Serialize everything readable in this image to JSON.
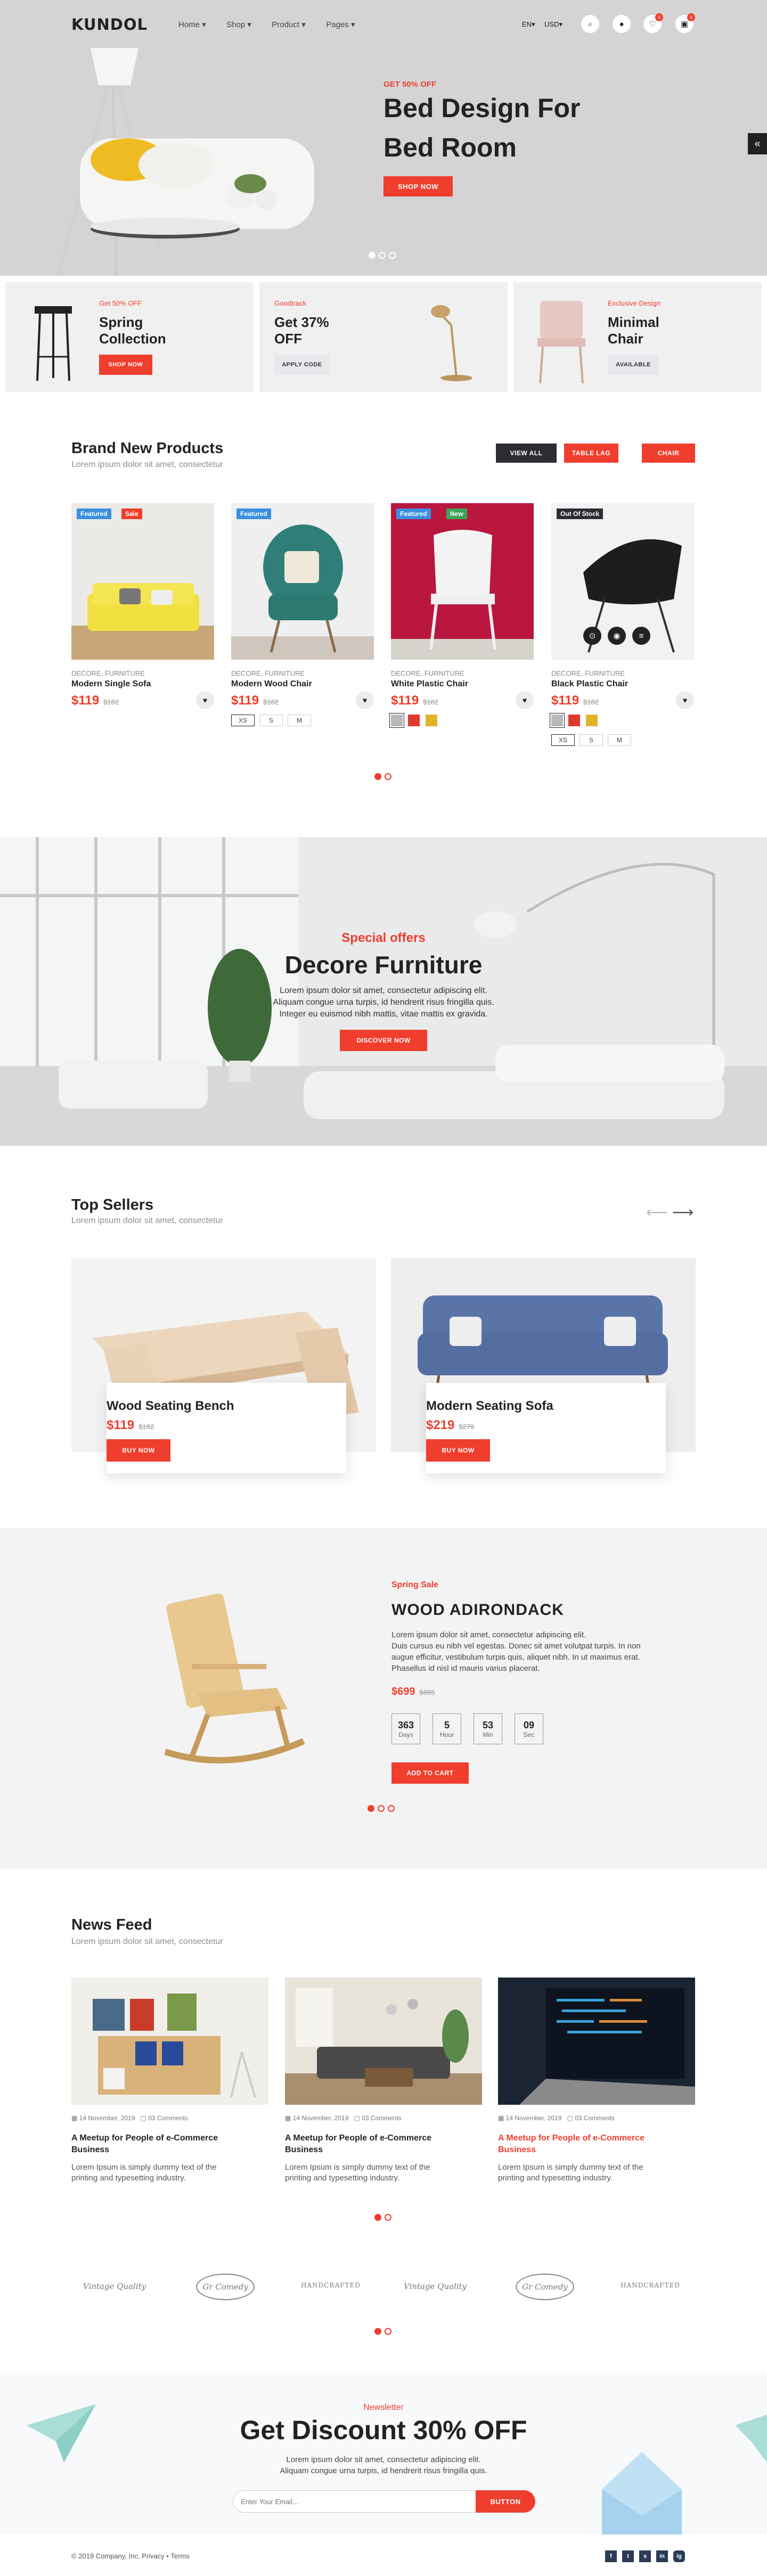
{
  "header": {
    "logo": "KUNDOL",
    "nav": [
      "Home",
      "Shop",
      "Product",
      "Pages"
    ],
    "currency": {
      "lang": "EN",
      "money": "USD"
    },
    "badges": {
      "wishlist": "0",
      "cart": "0"
    }
  },
  "hero": {
    "kicker": "GET 50% OFF",
    "title_line1": "Bed Design For",
    "title_line2": "Bed Room",
    "button": "SHOP NOW",
    "side_icon": "«"
  },
  "promos": [
    {
      "tag": "Get 50% OFF",
      "title_line1": "Spring",
      "title_line2": "Collection",
      "button": "SHOP NOW"
    },
    {
      "tag": "Goodtrack",
      "title_line1": "Get 37%",
      "title_line2": "OFF",
      "button": "APPLY CODE"
    },
    {
      "tag": "Exclusive Design",
      "title_line1": "Minimal",
      "title_line2": "Chair",
      "button": "AVAILABLE"
    }
  ],
  "new_products": {
    "title": "Brand New Products",
    "subtitle": "Lorem ipsum dolor sit amet, consectetur",
    "filters": [
      "VIEW ALL",
      "TABLE LAG",
      "CHAIR"
    ],
    "items": [
      {
        "tags": [
          "Featured",
          "Sale"
        ],
        "category": "DECORE, FURNITURE",
        "name": "Modern Single Sofa",
        "price": "$119",
        "old_price": "$182",
        "sizes": [],
        "swatches": []
      },
      {
        "tags": [
          "Featured"
        ],
        "category": "DECORE, FURNITURE",
        "name": "Modern Wood Chair",
        "price": "$119",
        "old_price": "$182",
        "sizes": [
          "XS",
          "S",
          "M"
        ],
        "swatches": []
      },
      {
        "tags": [
          "Featured",
          "New"
        ],
        "category": "DECORE, FURNITURE",
        "name": "White Plastic Chair",
        "price": "$119",
        "old_price": "$182",
        "sizes": [],
        "swatches": [
          "#b9b9b9",
          "#e0382d",
          "#e0b42a"
        ]
      },
      {
        "tags": [
          "Out Of Stock"
        ],
        "category": "DECORE, FURNITURE",
        "name": "Black Plastic Chair",
        "price": "$119",
        "old_price": "$182",
        "sizes": [
          "XS",
          "S",
          "M"
        ],
        "swatches": [
          "#b9b9b9",
          "#e0382d",
          "#e0b42a"
        ]
      }
    ]
  },
  "offer": {
    "kicker": "Special offers",
    "title": "Decore Furniture",
    "text_line1": "Lorem ipsum dolor sit amet, consectetur adipiscing elit.",
    "text_line2": "Aliquam congue urna turpis, id hendrerit risus fringilla quis.",
    "text_line3": "Integer eu euismod nibh mattis, vitae mattis ex gravida.",
    "button": "DISCOVER NOW"
  },
  "top_sellers": {
    "title": "Top Sellers",
    "subtitle": "Lorem ipsum dolor sit amet, consectetur",
    "items": [
      {
        "name": "Wood Seating Bench",
        "price": "$119",
        "old_price": "$182",
        "button": "BUY NOW"
      },
      {
        "name": "Modern Seating Sofa",
        "price": "$219",
        "old_price": "$279",
        "button": "BUY NOW"
      }
    ]
  },
  "deal": {
    "kicker": "Spring Sale",
    "title": "WOOD ADIRONDACK",
    "text_line1": "Lorem ipsum dolor sit amet, consectetur adipiscing elit.",
    "text_line2": "Duis cursus eu nibh vel egestas. Donec sit amet volutpat turpis. In non",
    "text_line3": "augue efficitur, vestibulum turpis quis, aliquet nibh. In ut maximus erat.",
    "text_line4": "Phasellus id nisl id mauris varius placerat.",
    "price": "$699",
    "old_price": "$685",
    "countdown": [
      {
        "value": "363",
        "unit": "Days"
      },
      {
        "value": "5",
        "unit": "Hour"
      },
      {
        "value": "53",
        "unit": "Min"
      },
      {
        "value": "09",
        "unit": "Sec"
      }
    ],
    "button": "ADD TO CART"
  },
  "news": {
    "title": "News Feed",
    "subtitle": "Lorem ipsum dolor sit amet, consectetur",
    "items": [
      {
        "date": "14 November, 2019",
        "comments": "03 Comments",
        "title_line1": "A Meetup for People of e-Commerce",
        "title_line2": "Business",
        "text_line1": "Lorem Ipsum is simply dummy text of the",
        "text_line2": "printing and typesetting industry."
      },
      {
        "date": "14 November, 2019",
        "comments": "03 Comments",
        "title_line1": "A Meetup for People of e-Commerce",
        "title_line2": "Business",
        "text_line1": "Lorem Ipsum is simply dummy text of the",
        "text_line2": "printing and typesetting industry."
      },
      {
        "date": "14 November, 2019",
        "comments": "03 Comments",
        "title_line1": "A Meetup for People of e-Commerce",
        "title_line2": "Business",
        "text_line1": "Lorem Ipsum is simply dummy text of the",
        "text_line2": "printing and typesetting industry."
      }
    ]
  },
  "brands": [
    "Vintage Quality",
    "Gr Comedy",
    "HANDCRAFTED",
    "Vintage Quality",
    "Gr Comedy",
    "HANDCRAFTED"
  ],
  "newsletter": {
    "kicker": "Newsletter",
    "title": "Get Discount 30% OFF",
    "text_line1": "Lorem ipsum dolor sit amet, consectetur adipiscing elit.",
    "text_line2": "Aliquam congue urna turpis, id hendrerit risus fringilla quis.",
    "placeholder": "Enter Your Email...",
    "button": "BUTTON"
  },
  "footer": {
    "copyright": "© 2019 Company, Inc. Privacy • Terms",
    "social": [
      "f",
      "t",
      "s",
      "in",
      "ig"
    ]
  }
}
